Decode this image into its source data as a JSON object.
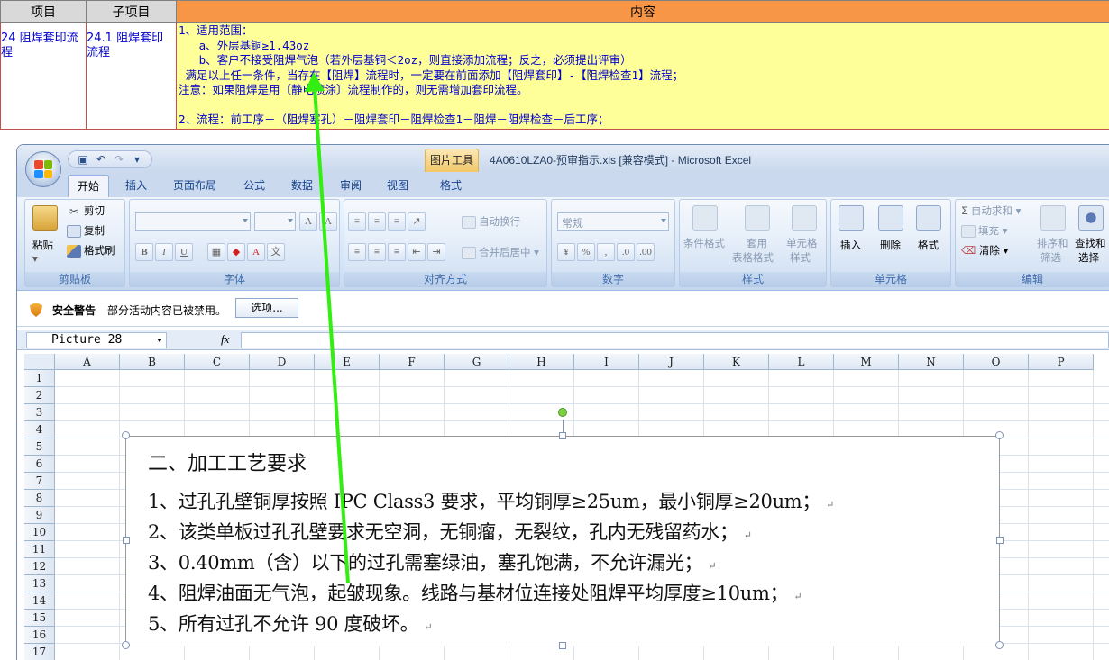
{
  "ref_table": {
    "headers": [
      "项目",
      "子项目",
      "内容"
    ],
    "row": {
      "item": "24 阻焊套印流程",
      "subitem": "24.1 阻焊套印流程",
      "content": "1、适用范围：\n   a、外层基铜≥1.43oz\n   b、客户不接受阻焊气泡（若外层基铜＜2oz，则直接添加流程；反之，必须提出评审）\n 满足以上任一条件，当存在【阻焊】流程时，一定要在前面添加【阻焊套印】-【阻焊检查1】流程；\n注意：如果阻焊是用〔静电喷涂〕流程制作的，则无需增加套印流程。\n\n2、流程：前工序－（阻焊塞孔）－阻焊套印－阻焊检查1－阻焊－阻焊检查－后工序；"
    }
  },
  "window": {
    "context_tab": "图片工具",
    "title": "4A0610LZA0-预审指示.xls  [兼容模式] - Microsoft Excel"
  },
  "tabs": [
    "开始",
    "插入",
    "页面布局",
    "公式",
    "数据",
    "审阅",
    "视图",
    "格式"
  ],
  "ribbon": {
    "clipboard": {
      "label": "剪贴板",
      "paste": "粘贴",
      "cut": "剪切",
      "copy": "复制",
      "format_painter": "格式刷"
    },
    "font": {
      "label": "字体"
    },
    "alignment": {
      "label": "对齐方式",
      "wrap": "自动换行",
      "merge": "合并后居中"
    },
    "number": {
      "label": "数字",
      "format": "常规"
    },
    "styles": {
      "label": "样式",
      "conditional": "条件格式",
      "table_format_1": "套用",
      "table_format_2": "表格格式",
      "cell_styles_1": "单元格",
      "cell_styles_2": "样式"
    },
    "cells": {
      "label": "单元格",
      "insert": "插入",
      "delete": "删除",
      "format": "格式"
    },
    "editing": {
      "label": "编辑",
      "autosum": "自动求和",
      "fill": "填充",
      "clear": "清除",
      "sort_1": "排序和",
      "sort_2": "筛选",
      "find_1": "查找和",
      "find_2": "选择"
    }
  },
  "security": {
    "title": "安全警告",
    "message": "部分活动内容已被禁用。",
    "options": "选项..."
  },
  "formula_bar": {
    "name_box": "Picture 28",
    "fx": "fx",
    "value": ""
  },
  "columns": [
    "A",
    "B",
    "C",
    "D",
    "E",
    "F",
    "G",
    "H",
    "I",
    "J",
    "K",
    "L",
    "M",
    "N",
    "O",
    "P"
  ],
  "rows": [
    "1",
    "2",
    "3",
    "4",
    "5",
    "6",
    "7",
    "8",
    "9",
    "10",
    "11",
    "12",
    "13",
    "14",
    "15",
    "16",
    "17"
  ],
  "picture": {
    "title": "二、加工工艺要求",
    "lines": [
      "1、过孔孔壁铜厚按照 IPC Class3 要求，平均铜厚≥25um，最小铜厚≥20um；",
      "2、该类单板过孔孔壁要求无空洞，无铜瘤，无裂纹，孔内无残留药水；",
      "3、0.40mm（含）以下的过孔需塞绿油，塞孔饱满，不允许漏光；",
      "4、阻焊油面无气泡，起皱现象。线路与基材位连接处阻焊平均厚度≥10um；",
      "5、所有过孔不允许 90 度破坏。"
    ],
    "return_mark": "↵"
  },
  "colors": {
    "table_border": "#c0504d",
    "content_fill": "#ffff99",
    "content_text": "#0000cc",
    "header_orange": "#f79646",
    "arrow": "#33ee11"
  }
}
